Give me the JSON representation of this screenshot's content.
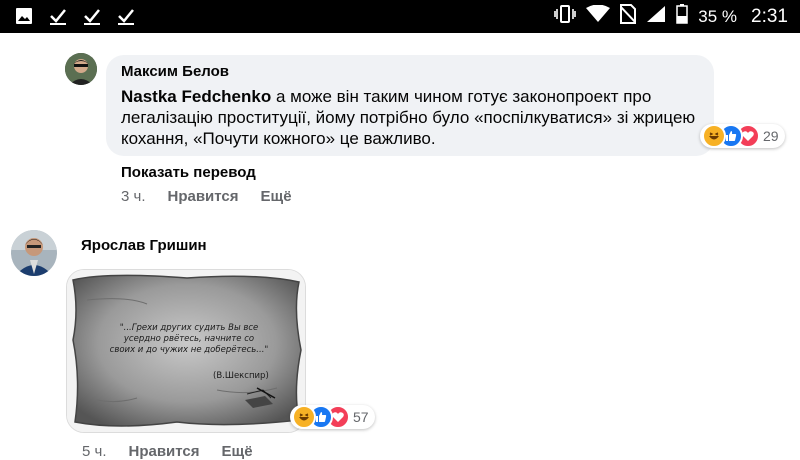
{
  "status_bar": {
    "battery_percent": "35 %",
    "time": "2:31",
    "left_icons": [
      "image-icon",
      "check-icon",
      "check-icon",
      "check-icon"
    ],
    "right_icons": [
      "vibrate-icon",
      "wifi-icon",
      "no-sim-icon",
      "signal-icon",
      "battery-icon"
    ]
  },
  "comments": [
    {
      "author": "Максим Белов",
      "mention": "Nastka Fedchenko",
      "text": " а може він таким чином готує законопроект про легалізацію проституції, йому потрібно було «поспілкуватися» зі жрицею кохання, «Почути кожного» це важливо.",
      "reaction_count": "29",
      "reaction_icons": [
        "haha-reaction-icon",
        "like-reaction-icon",
        "love-reaction-icon"
      ],
      "translate_label": "Показать перевод",
      "time": "3 ч.",
      "like_label": "Нравится",
      "more_label": "Ещё"
    },
    {
      "author": "Ярослав Гришин",
      "image_quote_lines": [
        "\"...Грехи других судить Вы все",
        "усердно рвётесь, начните со",
        "своих и до чужих не доберётесь...\""
      ],
      "image_quote_author": "(В.Шекспир)",
      "reaction_count": "57",
      "reaction_icons": [
        "haha-reaction-icon",
        "like-reaction-icon",
        "love-reaction-icon"
      ],
      "time": "5 ч.",
      "like_label": "Нравится",
      "more_label": "Ещё"
    }
  ],
  "colors": {
    "bubble": "#f0f2f5",
    "meta_text": "#65676b",
    "like_blue": "#1877f2",
    "love_red": "#f33e58",
    "haha_yellow": "#f7b125"
  }
}
